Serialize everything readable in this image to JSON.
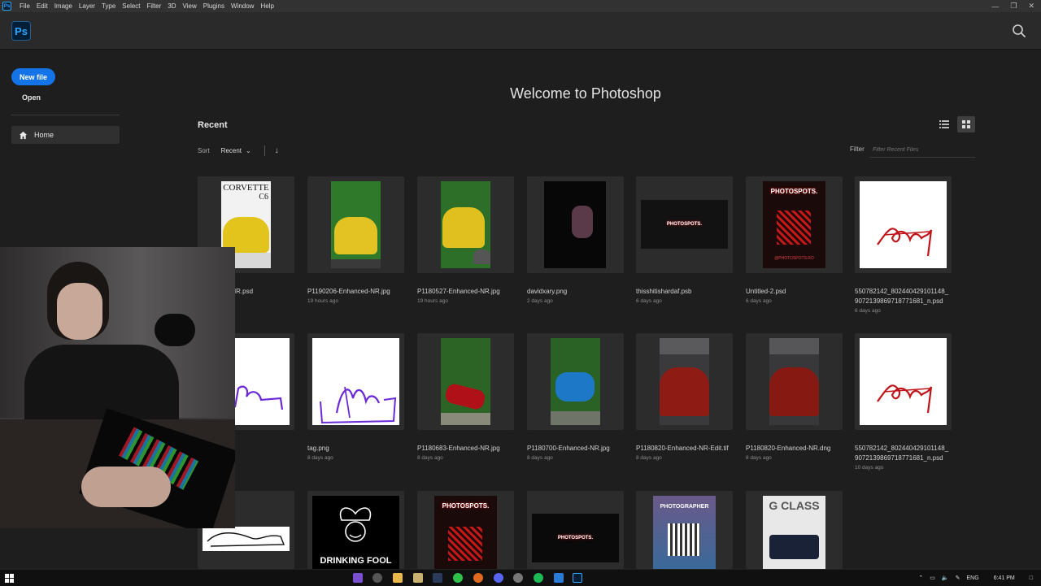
{
  "menubar": {
    "app_icon": "Ps",
    "items": [
      "File",
      "Edit",
      "Image",
      "Layer",
      "Type",
      "Select",
      "Filter",
      "3D",
      "View",
      "Plugins",
      "Window",
      "Help"
    ]
  },
  "appbar": {
    "logo": "Ps"
  },
  "sidebar": {
    "new_file": "New file",
    "open": "Open",
    "home": "Home"
  },
  "main": {
    "welcome": "Welcome to Photoshop",
    "recent_title": "Recent",
    "sort_label": "Sort",
    "sort_value": "Recent",
    "filter_label": "Filter",
    "filter_placeholder": "Filter Recent Files"
  },
  "files": [
    {
      "name": "…nhanced-NR.psd",
      "age": ""
    },
    {
      "name": "P1190206-Enhanced-NR.jpg",
      "age": "19 hours ago"
    },
    {
      "name": "P1180527-Enhanced-NR.jpg",
      "age": "19 hours ago"
    },
    {
      "name": "davidxary.png",
      "age": "2 days ago"
    },
    {
      "name": "thisshitishardaf.psb",
      "age": "6 days ago"
    },
    {
      "name": "Untitled-2.psd",
      "age": "6 days ago"
    },
    {
      "name": "550782142_802440429101148_9072139869718771681_n.psd",
      "age": "6 days ago"
    },
    {
      "name": "",
      "age": ""
    },
    {
      "name": "tag.png",
      "age": "8 days ago"
    },
    {
      "name": "P1180683-Enhanced-NR.jpg",
      "age": "8 days ago"
    },
    {
      "name": "P1180700-Enhanced-NR.jpg",
      "age": "8 days ago"
    },
    {
      "name": "P1180820-Enhanced-NR-Edit.tif",
      "age": "8 days ago"
    },
    {
      "name": "P1180820-Enhanced-NR.dng",
      "age": "8 days ago"
    },
    {
      "name": "550782142_802440429101148_9072139869718771681_n.psd",
      "age": "10 days ago"
    }
  ],
  "thumb_text": {
    "corvette": "CORVETTE",
    "corvette_sub": "C6",
    "photospots": "PHOTOSPOTS.",
    "photospots_url": "@PHOTOSPOTS.RO",
    "drinking": "DRINKING FOOL",
    "photographer": "PHOTOGRAPHER",
    "gclass": "G CLASS"
  },
  "taskbar": {
    "lang": "ENG",
    "time": "6:41 PM"
  },
  "colors": {
    "accent": "#1473e6",
    "ps_blue": "#31a8ff",
    "bg": "#1e1e1e"
  }
}
